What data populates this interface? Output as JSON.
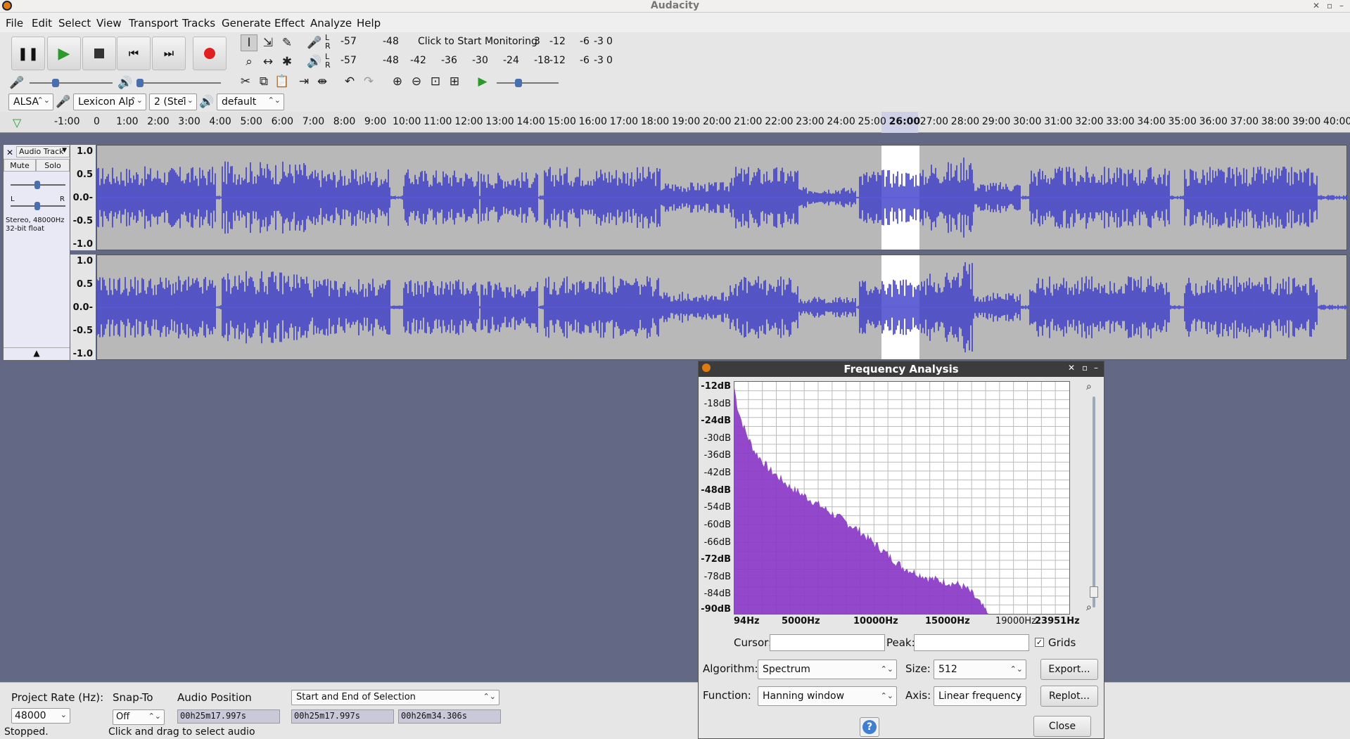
{
  "window": {
    "title": "Audacity"
  },
  "menu": [
    "File",
    "Edit",
    "Select",
    "View",
    "Transport",
    "Tracks",
    "Generate",
    "Effect",
    "Analyze",
    "Help"
  ],
  "meters": {
    "record_prompt": "Click to Start Monitoring",
    "scale": [
      "-57",
      "-48",
      "-42",
      "-36",
      "-30",
      "-24",
      "-18",
      "-12",
      "-6",
      "-3",
      "0"
    ],
    "record_scale_tail": [
      "3",
      "-12",
      "-6",
      "-3",
      "0"
    ]
  },
  "device": {
    "host": "ALSA",
    "mic": "Lexicon Alp",
    "channels": "2 (Stei",
    "speaker": "default"
  },
  "ruler": [
    "-1:00",
    "0",
    "1:00",
    "2:00",
    "3:00",
    "4:00",
    "5:00",
    "6:00",
    "7:00",
    "8:00",
    "9:00",
    "10:00",
    "11:00",
    "12:00",
    "13:00",
    "14:00",
    "15:00",
    "16:00",
    "17:00",
    "18:00",
    "19:00",
    "20:00",
    "21:00",
    "22:00",
    "23:00",
    "24:00",
    "25:00",
    "26:00",
    "27:00",
    "28:00",
    "29:00",
    "30:00",
    "31:00",
    "32:00",
    "33:00",
    "34:00",
    "35:00",
    "36:00",
    "37:00",
    "38:00",
    "39:00",
    "40:00"
  ],
  "track": {
    "name": "Audio Track",
    "mute": "Mute",
    "solo": "Solo",
    "lr_left": "L",
    "lr_right": "R",
    "info1": "Stereo, 48000Hz",
    "info2": "32-bit float",
    "scale": [
      "1.0",
      "0.5",
      "0.0-",
      "-0.5",
      "-1.0"
    ]
  },
  "bottom": {
    "project_rate_label": "Project Rate (Hz):",
    "project_rate": "48000",
    "snap_label": "Snap-To",
    "snap_value": "Off",
    "audio_pos_label": "Audio Position",
    "audio_pos": "00h25m17.997s",
    "selection_mode": "Start and End of Selection",
    "sel_start": "00h25m17.997s",
    "sel_end": "00h26m34.306s"
  },
  "status": {
    "state": "Stopped.",
    "hint": "Click and drag to select audio"
  },
  "dialog": {
    "title": "Frequency Analysis",
    "cursor_label": "Cursor:",
    "peak_label": "Peak:",
    "grids_label": "Grids",
    "grids_checked": true,
    "algorithm_label": "Algorithm:",
    "algorithm": "Spectrum",
    "size_label": "Size:",
    "size": "512",
    "function_label": "Function:",
    "function": "Hanning window",
    "axis_label": "Axis:",
    "axis": "Linear frequency",
    "export": "Export...",
    "replot": "Replot...",
    "close": "Close",
    "help": "?",
    "y_labels": [
      "-12dB",
      "-18dB",
      "-24dB",
      "-30dB",
      "-36dB",
      "-42dB",
      "-48dB",
      "-54dB",
      "-60dB",
      "-66dB",
      "-72dB",
      "-78dB",
      "-84dB",
      "-90dB"
    ],
    "x_labels": [
      "94Hz",
      "5000Hz",
      "10000Hz",
      "15000Hz",
      "19000Hz",
      "23951Hz"
    ]
  },
  "chart_data": {
    "type": "area",
    "title": "Frequency Analysis",
    "xlabel": "",
    "ylabel": "",
    "xlim": [
      94,
      23951
    ],
    "ylim": [
      -90,
      -12
    ],
    "x": [
      94,
      300,
      600,
      1000,
      1500,
      2000,
      2500,
      3000,
      3500,
      4000,
      5000,
      6000,
      7000,
      8000,
      9000,
      10000,
      11000,
      12000,
      13000,
      14000,
      15000,
      16000,
      16500,
      17000,
      17500,
      18000,
      18200
    ],
    "y": [
      -14,
      -20,
      -25,
      -30,
      -35,
      -38,
      -41,
      -43,
      -45,
      -47,
      -50,
      -53,
      -56,
      -59,
      -62,
      -66,
      -70,
      -74,
      -76,
      -78,
      -79,
      -80,
      -81,
      -83,
      -86,
      -89,
      -90
    ]
  }
}
